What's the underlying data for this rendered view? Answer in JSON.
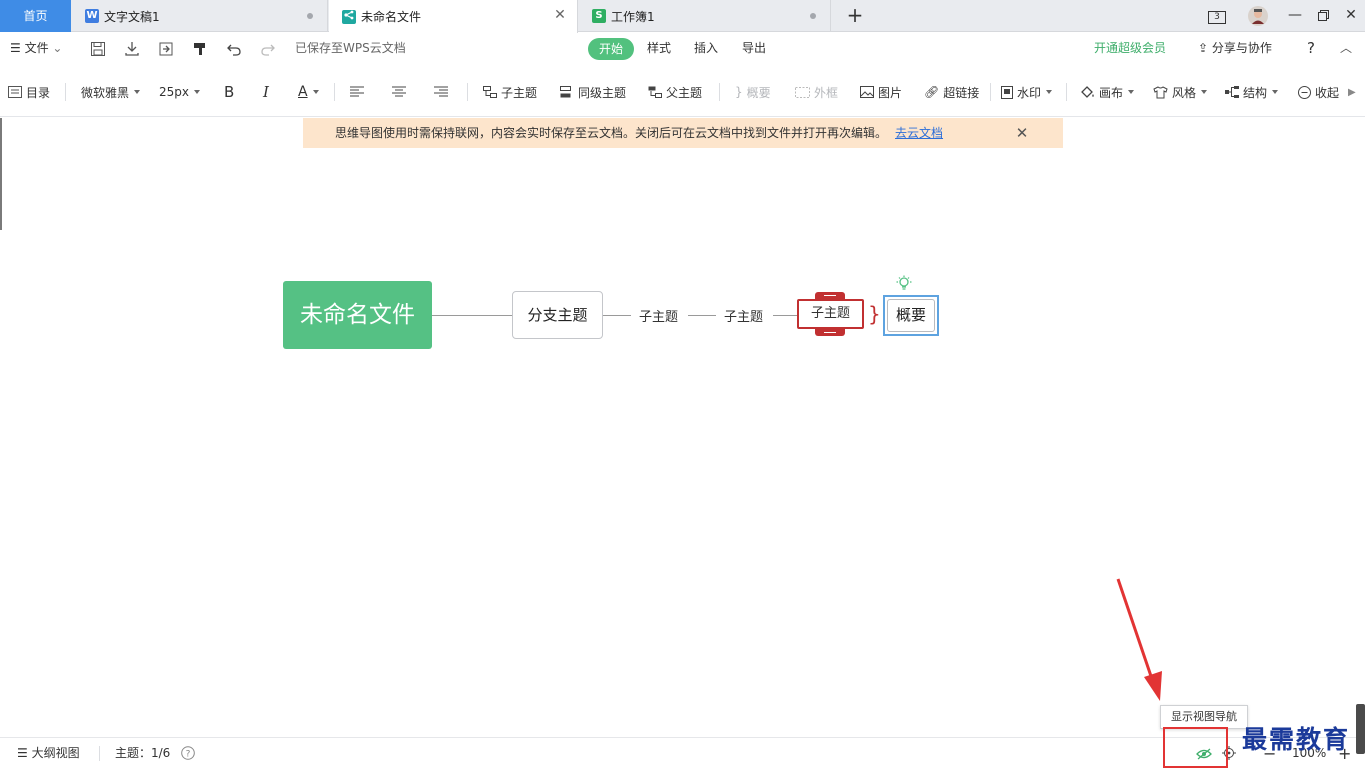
{
  "tabs": {
    "home": "首页",
    "doc": "文字文稿1",
    "mindmap": "未命名文件",
    "sheet": "工作簿1",
    "doc_icon": "W",
    "sheet_icon": "S",
    "badge": "3"
  },
  "menu": {
    "file": "文件",
    "saved_status": "已保存至WPS云文档",
    "start": "开始",
    "style": "样式",
    "insert": "插入",
    "export": "导出",
    "vip": "开通超级会员",
    "share": "分享与协作",
    "help": "?"
  },
  "toolbar": {
    "outline": "目录",
    "font": "微软雅黑",
    "size": "25px",
    "bold": "B",
    "italic": "I",
    "font_color": "A",
    "child_topic": "子主题",
    "sibling_topic": "同级主题",
    "parent_topic": "父主题",
    "summary": "概要",
    "frame": "外框",
    "image": "图片",
    "hyperlink": "超链接",
    "watermark": "水印",
    "canvas": "画布",
    "theme": "风格",
    "structure": "结构",
    "collapse": "收起"
  },
  "notice": {
    "text": "思维导图使用时需保持联网，内容会实时保存至云文档。关闭后可在云文档中找到文件并打开再次编辑。",
    "link": "去云文档"
  },
  "mindmap": {
    "root": "未命名文件",
    "branch": "分支主题",
    "sub1": "子主题",
    "sub2": "子主题",
    "sub3": "子主题",
    "summary": "概要"
  },
  "status": {
    "outline_view": "大纲视图",
    "topic_count": "主题：1/6",
    "tooltip": "显示视图导航",
    "zoom": "100%"
  },
  "overlay": {
    "watermark_text": "最需教育"
  },
  "colors": {
    "root": "#55c184",
    "accent": "#3f8ce6",
    "selected": "#c13031",
    "annotation": "#e23434"
  }
}
